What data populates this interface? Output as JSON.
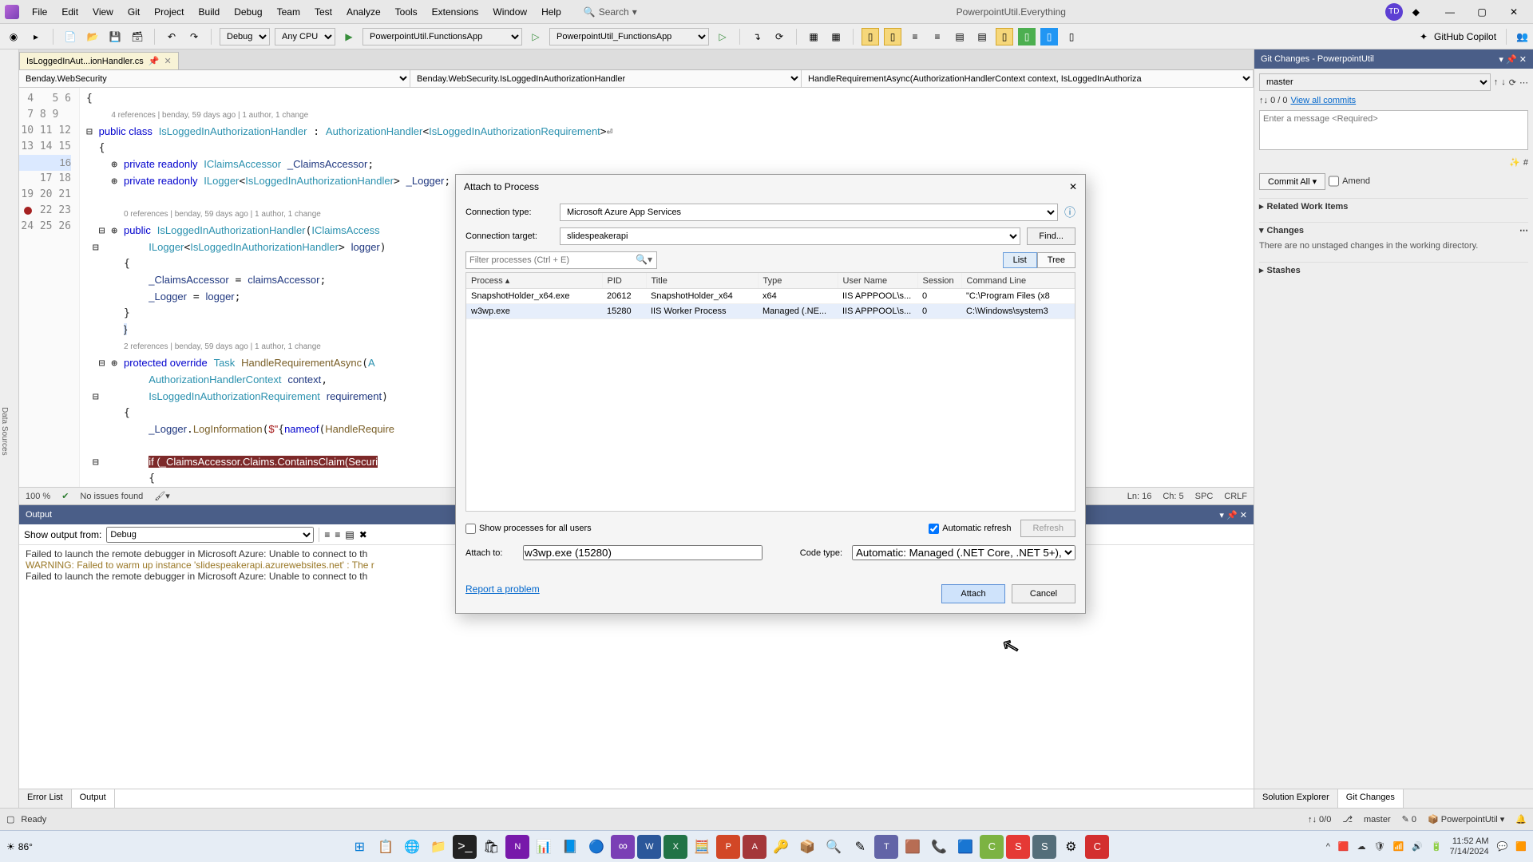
{
  "menubar": [
    "File",
    "Edit",
    "View",
    "Git",
    "Project",
    "Build",
    "Debug",
    "Team",
    "Test",
    "Analyze",
    "Tools",
    "Extensions",
    "Window",
    "Help"
  ],
  "searchLabel": "Search",
  "appTitle": "PowerpointUtil.Everything",
  "toolbar": {
    "config": "Debug",
    "platform": "Any CPU",
    "target1": "PowerpointUtil.FunctionsApp",
    "target2": "PowerpointUtil_FunctionsApp",
    "copilot": "GitHub Copilot"
  },
  "tab": {
    "name": "IsLoggedInAut...ionHandler.cs"
  },
  "crumbs": {
    "a": "Benday.WebSecurity",
    "b": "Benday.WebSecurity.IsLoggedInAuthorizationHandler",
    "c": "HandleRequirementAsync(AuthorizationHandlerContext context, IsLoggedInAuthoriza"
  },
  "code": {
    "ref1": "4 references | benday, 59 days ago | 1 author, 1 change",
    "ref2": "0 references | benday, 59 days ago | 1 author, 1 change",
    "ref3": "2 references | benday, 59 days ago | 1 author, 1 change"
  },
  "editorStatus": {
    "zoom": "100 %",
    "issues": "No issues found",
    "ln": "Ln: 16",
    "ch": "Ch: 5",
    "spc": "SPC",
    "crlf": "CRLF"
  },
  "output": {
    "title": "Output",
    "showFrom": "Show output from:",
    "source": "Debug",
    "line1": "Failed to launch the remote debugger in Microsoft Azure: Unable to connect to th",
    "line2": "WARNING: Failed to warm up instance 'slidespeakerapi.azurewebsites.net' : The r",
    "line3": "Failed to launch the remote debugger in Microsoft Azure: Unable to connect to th",
    "tabErr": "Error List",
    "tabOut": "Output"
  },
  "git": {
    "title": "Git Changes - PowerpointUtil",
    "branch": "master",
    "counts": "0 / 0",
    "viewAll": "View all commits",
    "msgPlaceholder": "Enter a message <Required>",
    "commitAll": "Commit All",
    "amend": "Amend",
    "related": "Related Work Items",
    "changes": "Changes",
    "noChanges": "There are no unstaged changes in the working directory.",
    "stashes": "Stashes",
    "tabSoln": "Solution Explorer",
    "tabGit": "Git Changes"
  },
  "status": {
    "ready": "Ready",
    "branch": "master",
    "proj": "PowerpointUtil"
  },
  "dialog": {
    "title": "Attach to Process",
    "connTypeLabel": "Connection type:",
    "connType": "Microsoft Azure App Services",
    "connTargetLabel": "Connection target:",
    "connTarget": "slidespeakerapi",
    "find": "Find...",
    "filterPlaceholder": "Filter processes (Ctrl + E)",
    "list": "List",
    "tree": "Tree",
    "cols": {
      "process": "Process",
      "pid": "PID",
      "title": "Title",
      "type": "Type",
      "user": "User Name",
      "session": "Session",
      "cmd": "Command Line"
    },
    "rows": [
      {
        "process": "SnapshotHolder_x64.exe",
        "pid": "20612",
        "title": "SnapshotHolder_x64",
        "type": "x64",
        "user": "IIS APPPOOL\\s...",
        "session": "0",
        "cmd": "\"C:\\Program Files (x8"
      },
      {
        "process": "w3wp.exe",
        "pid": "15280",
        "title": "IIS Worker Process",
        "type": "Managed (.NE...",
        "user": "IIS APPPOOL\\s...",
        "session": "0",
        "cmd": "C:\\Windows\\system3"
      }
    ],
    "showAll": "Show processes for all users",
    "autoRefresh": "Automatic refresh",
    "refresh": "Refresh",
    "attachToLabel": "Attach to:",
    "attachTo": "w3wp.exe (15280)",
    "codeTypeLabel": "Code type:",
    "codeType": "Automatic: Managed (.NET Core, .NET 5+), Manage",
    "report": "Report a problem",
    "attach": "Attach",
    "cancel": "Cancel"
  },
  "taskbar": {
    "temp": "86°",
    "time": "11:52 AM",
    "date": "7/14/2024"
  },
  "leftGutter": "Data Sources"
}
